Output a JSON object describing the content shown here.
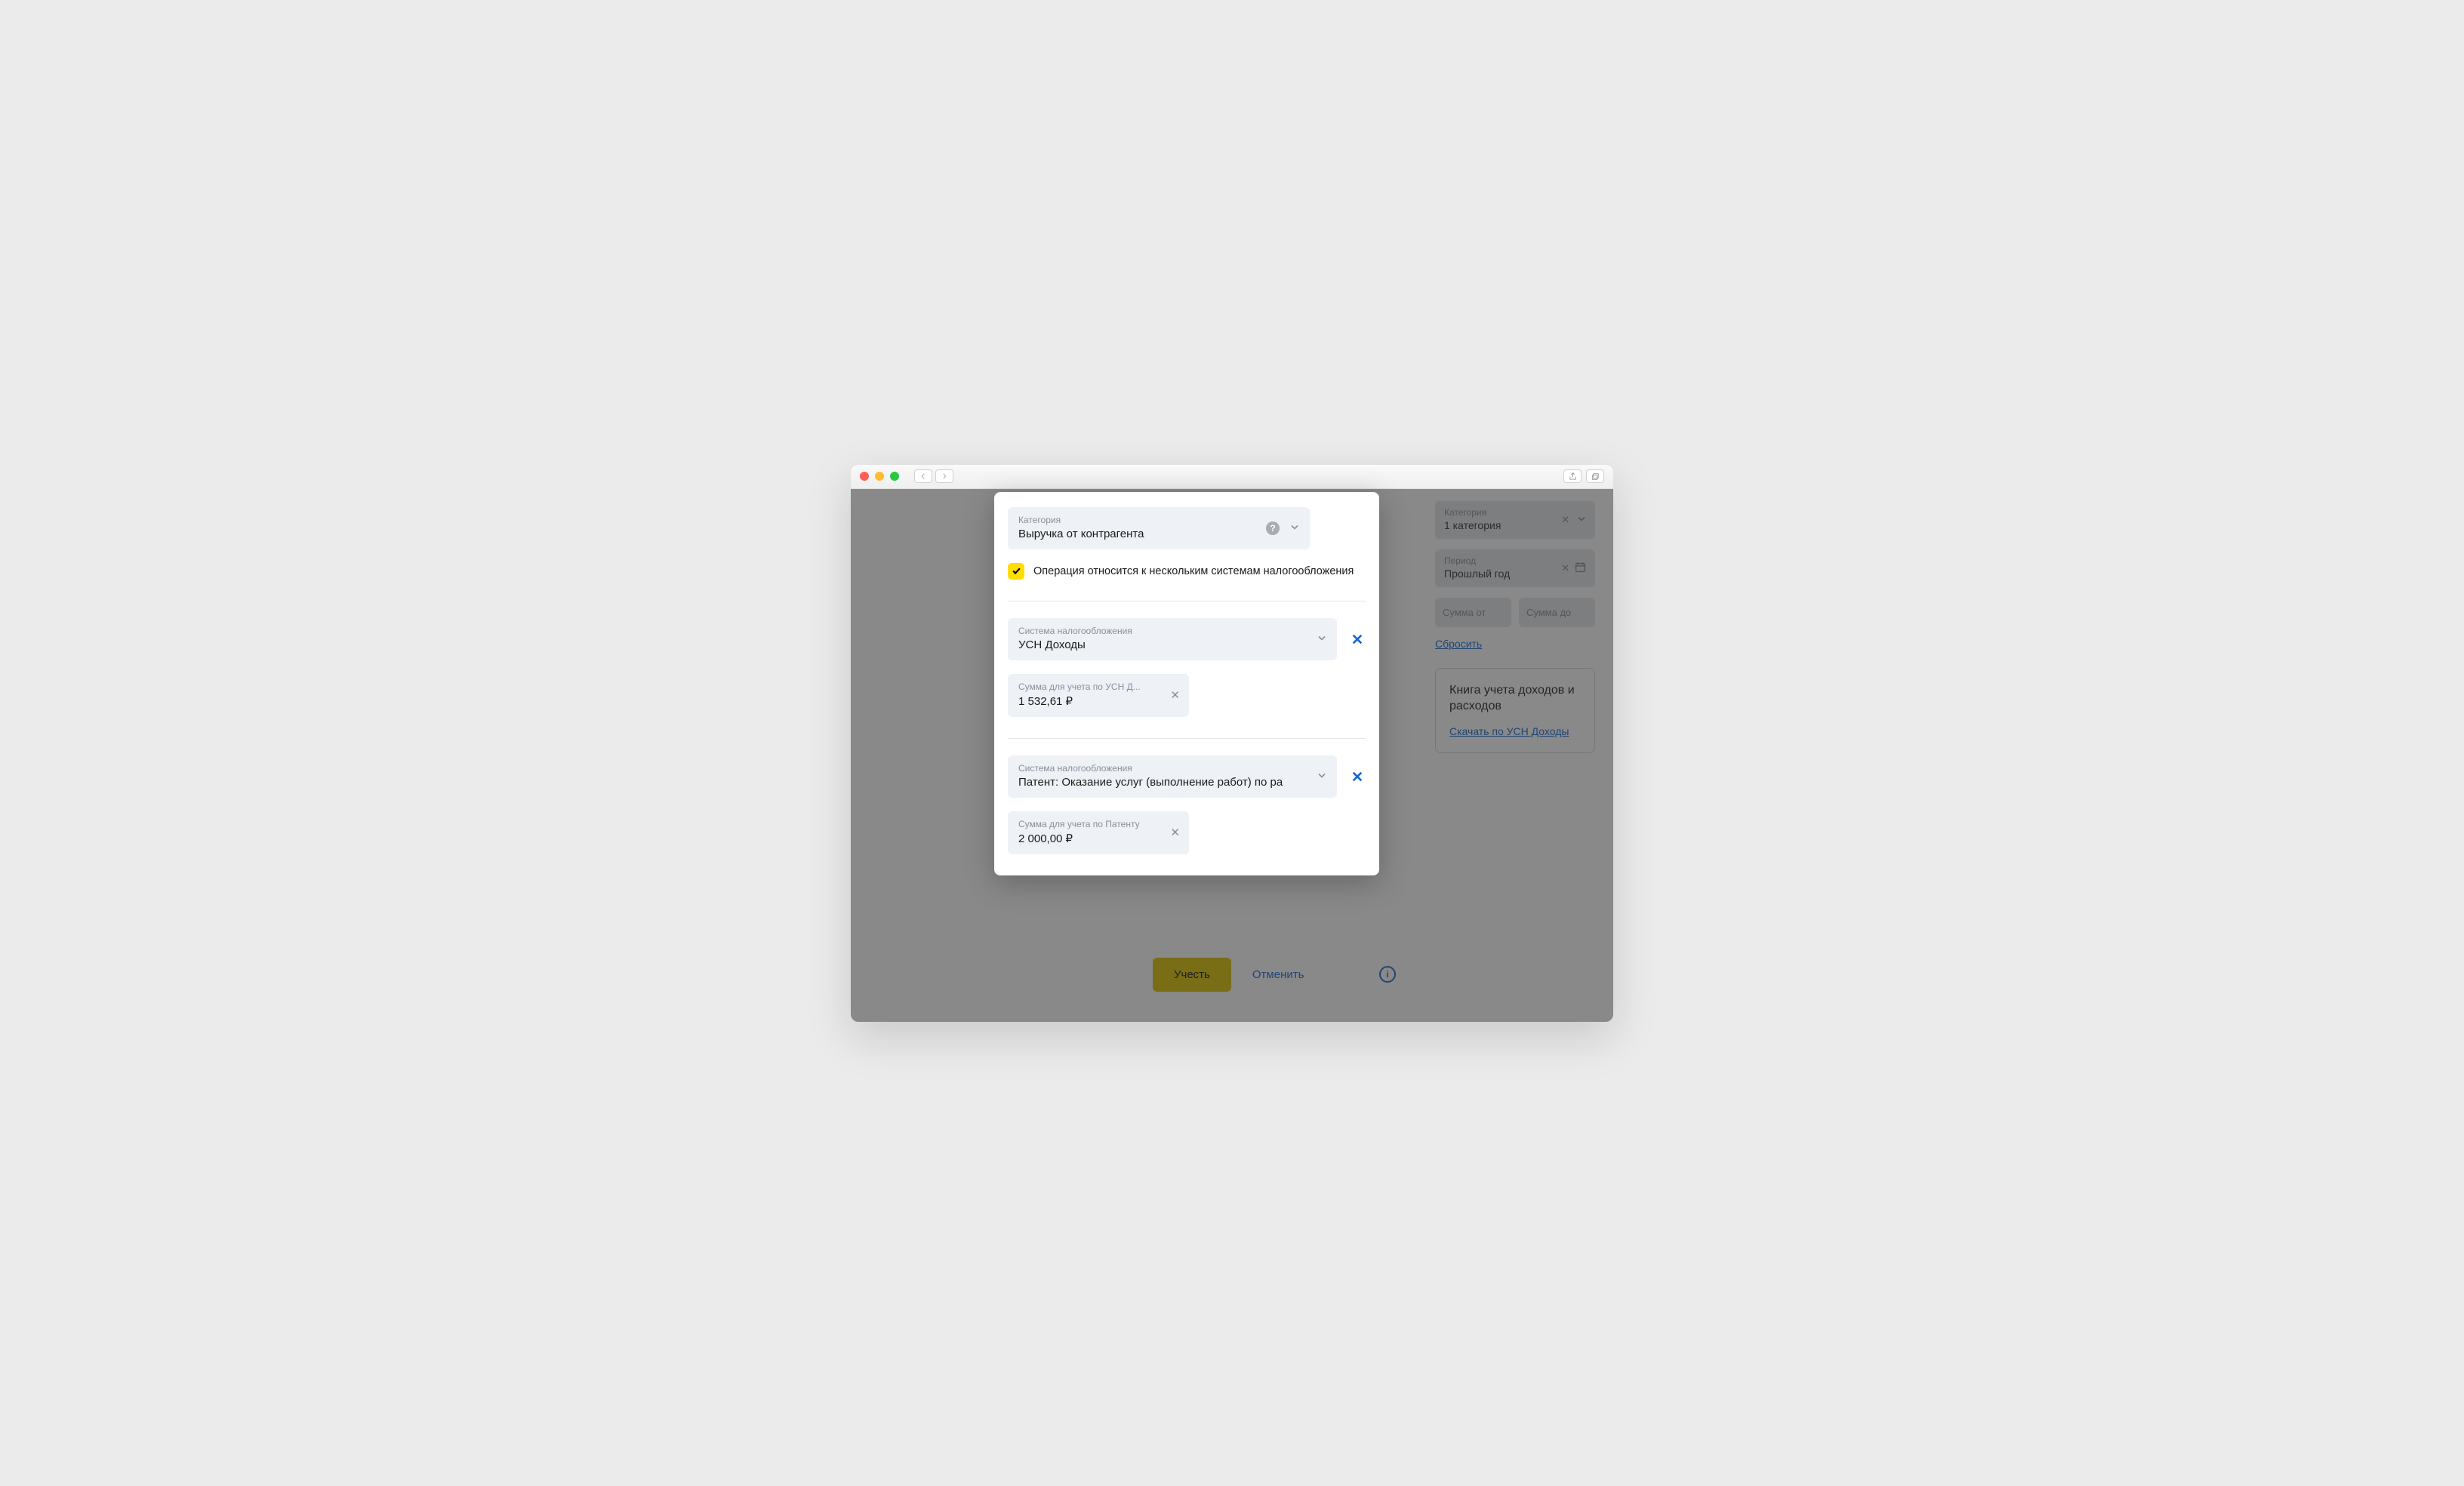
{
  "modal": {
    "category": {
      "label": "Категория",
      "value": "Выручка от контрагента"
    },
    "multi_tax_checkbox": "Операция относится к нескольким системам налогообложения",
    "tax_systems": [
      {
        "system_label": "Система налогообложения",
        "system_value": "УСН Доходы",
        "amount_label": "Сумма для учета по УСН Д...",
        "amount_value": "1 532,61 ₽"
      },
      {
        "system_label": "Система налогообложения",
        "system_value": "Патент: Оказание услуг (выполнение работ) по ра",
        "amount_label": "Сумма для учета по Патенту",
        "amount_value": "2 000,00 ₽"
      }
    ]
  },
  "filters": {
    "category": {
      "label": "Категория",
      "value": "1 категория"
    },
    "period": {
      "label": "Период",
      "value": "Прошлый год"
    },
    "sum_from_placeholder": "Сумма от",
    "sum_to_placeholder": "Сумма до",
    "reset": "Сбросить"
  },
  "kudir": {
    "title": "Книга учета доходов и расходов",
    "download": "Скачать по УСН Доходы"
  },
  "actions": {
    "submit": "Учесть",
    "cancel": "Отменить"
  }
}
